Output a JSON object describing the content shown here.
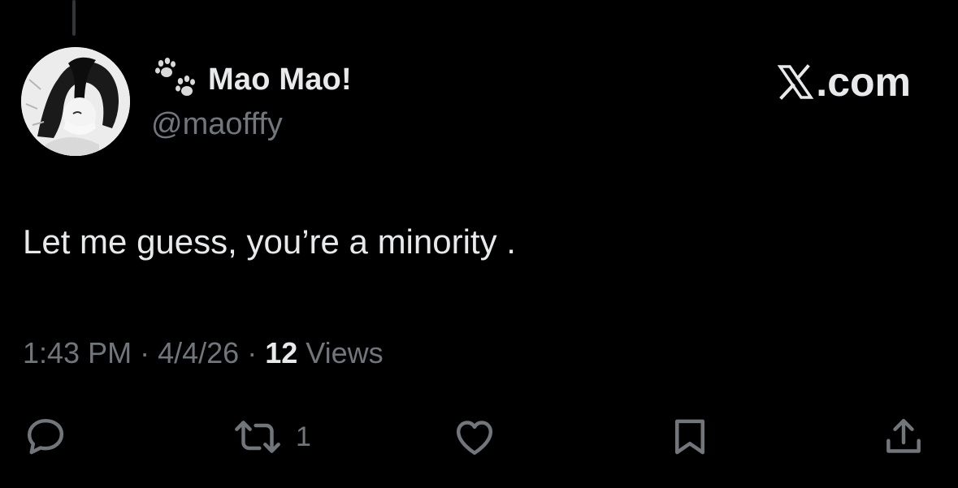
{
  "author": {
    "display_name": "Mao Mao!",
    "handle": "@maofffy",
    "name_emoji_icon": "paw-prints-icon"
  },
  "brand": {
    "label": ".com",
    "logo_icon": "x-logo-icon"
  },
  "tweet": {
    "text": "Let me guess, you’re a minority ."
  },
  "meta": {
    "time": "1:43 PM",
    "separator": "·",
    "date": "4/4/26",
    "views_count": "12",
    "views_label": "Views"
  },
  "actions": {
    "reply": {
      "icon": "reply-icon"
    },
    "repost": {
      "icon": "repost-icon",
      "count": "1"
    },
    "like": {
      "icon": "heart-icon"
    },
    "bookmark": {
      "icon": "bookmark-icon"
    },
    "share": {
      "icon": "share-icon"
    }
  },
  "colors": {
    "background": "#000000",
    "primary_text": "#e7e9ea",
    "secondary_text": "#71767b",
    "thread_line": "#333639"
  }
}
